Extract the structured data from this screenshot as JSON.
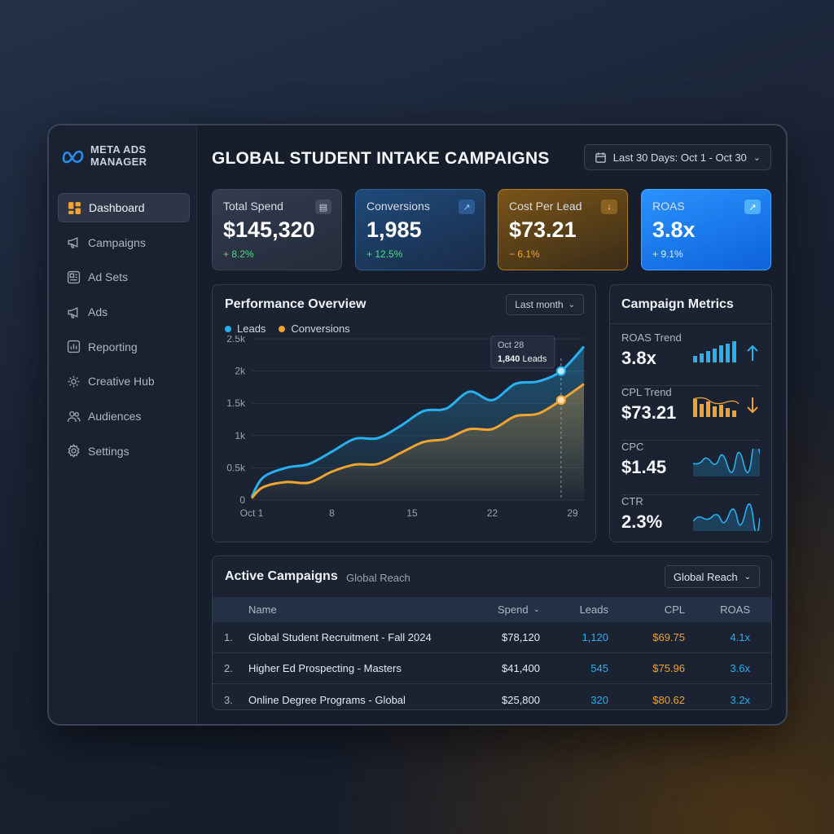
{
  "brand": {
    "name": "META ADS MANAGER"
  },
  "sidebar": {
    "items": [
      {
        "label": "Dashboard",
        "icon": "grid-icon",
        "active": true
      },
      {
        "label": "Campaigns",
        "icon": "megaphone-icon"
      },
      {
        "label": "Ad Sets",
        "icon": "layers-icon"
      },
      {
        "label": "Ads",
        "icon": "megaphone-icon"
      },
      {
        "label": "Reporting",
        "icon": "bar-chart-icon"
      },
      {
        "label": "Creative Hub",
        "icon": "gear-icon"
      },
      {
        "label": "Audiences",
        "icon": "users-icon"
      },
      {
        "label": "Settings",
        "icon": "settings-icon"
      }
    ]
  },
  "header": {
    "title": "GLOBAL STUDENT INTAKE CAMPAIGNS",
    "date_range": "Last 30 Days: Oct 1 - Oct 30"
  },
  "kpis": [
    {
      "label": "Total Spend",
      "value": "$145,320",
      "delta": "+ 8.2%",
      "delta_color": "#4ade80"
    },
    {
      "label": "Conversions",
      "value": "1,985",
      "delta": "+ 12.5%",
      "delta_color": "#4ade80"
    },
    {
      "label": "Cost Per Lead",
      "value": "$73.21",
      "delta": "− 6.1%",
      "delta_color": "#f5a623"
    },
    {
      "label": "ROAS",
      "value": "3.8x",
      "delta": "+ 9.1%",
      "delta_color": "#d7ecff"
    }
  ],
  "performance": {
    "title": "Performance Overview",
    "period": "Last month",
    "legend": [
      "Leads",
      "Conversions"
    ],
    "tooltip": {
      "date": "Oct 28",
      "value": "1,840",
      "unit": "Leads"
    }
  },
  "chart_data": {
    "type": "area",
    "x": [
      1,
      2,
      4,
      6,
      8,
      10,
      12,
      14,
      16,
      18,
      20,
      22,
      24,
      26,
      28,
      30
    ],
    "xticks": [
      "Oct 1",
      "8",
      "15",
      "22",
      "29"
    ],
    "ylim": [
      0,
      2500
    ],
    "yticks": [
      "0",
      "0.5k",
      "1k",
      "1.5k",
      "2k",
      "2.5k"
    ],
    "series": [
      {
        "name": "Leads",
        "color": "#29b0f0",
        "values": [
          50,
          350,
          500,
          560,
          750,
          950,
          960,
          1150,
          1380,
          1420,
          1680,
          1550,
          1800,
          1840,
          2000,
          2380
        ]
      },
      {
        "name": "Conversions",
        "color": "#f0a431",
        "values": [
          30,
          200,
          280,
          270,
          440,
          550,
          560,
          730,
          900,
          950,
          1100,
          1100,
          1300,
          1340,
          1550,
          1800
        ]
      }
    ],
    "highlight": {
      "x": 28,
      "label": "Oct 28"
    }
  },
  "metrics": {
    "title": "Campaign Metrics",
    "rows": [
      {
        "label": "ROAS Trend",
        "value": "3.8x",
        "trend": "up"
      },
      {
        "label": "CPL Trend",
        "value": "$73.21",
        "trend": "down"
      },
      {
        "label": "CPC",
        "value": "$1.45"
      },
      {
        "label": "CTR",
        "value": "2.3%"
      }
    ]
  },
  "campaigns": {
    "title": "Active Campaigns",
    "subtitle": "Global Reach",
    "filter": "Global Reach",
    "columns": [
      "Name",
      "Spend",
      "Leads",
      "CPL",
      "ROAS"
    ],
    "rows": [
      {
        "idx": "1.",
        "name": "Global Student Recruitment - Fall 2024",
        "spend": "$78,120",
        "leads": "1,120",
        "cpl": "$69.75",
        "roas": "4.1x"
      },
      {
        "idx": "2.",
        "name": "Higher Ed Prospecting - Masters",
        "spend": "$41,400",
        "leads": "545",
        "cpl": "$75.96",
        "roas": "3.6x"
      },
      {
        "idx": "3.",
        "name": "Online Degree Programs - Global",
        "spend": "$25,800",
        "leads": "320",
        "cpl": "$80.62",
        "roas": "3.2x"
      }
    ]
  },
  "colors": {
    "accent_blue": "#29b0f0",
    "accent_orange": "#f0a431",
    "positive": "#4ade80"
  }
}
